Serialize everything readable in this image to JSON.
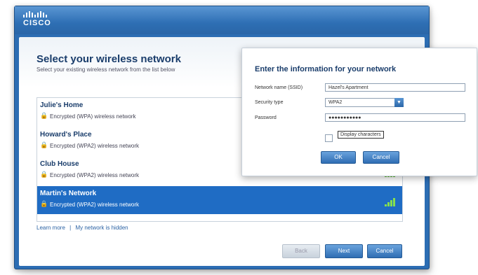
{
  "brand": {
    "logo_text": "CISCO"
  },
  "main": {
    "heading": "Select your wireless network",
    "subheading": "Select your existing wireless network from the list below",
    "networks": [
      {
        "name": "Julie's Home",
        "security": "Encrypted (WPA) wireless network",
        "speed": "",
        "selected": false
      },
      {
        "name": "Howard's Place",
        "security": "Encrypted (WPA2) wireless network",
        "speed": "",
        "selected": false
      },
      {
        "name": "Club House",
        "security": "Encrypted (WPA2) wireless network",
        "speed": "",
        "selected": false
      },
      {
        "name": "Martin's Network",
        "security": "Encrypted (WPA2) wireless network",
        "speed": "",
        "selected": true
      }
    ],
    "links": {
      "learn_more": "Learn more",
      "separator": "|",
      "not_listed": "My network is hidden"
    },
    "buttons": {
      "back": "Back",
      "next": "Next",
      "cancel": "Cancel"
    }
  },
  "dialog": {
    "title": "Enter the information for your network",
    "ssid_label": "Network name (SSID)",
    "ssid_value": "Hazel's Apartment",
    "security_label": "Security type",
    "security_value": "WPA2",
    "password_label": "Password",
    "password_value": "●●●●●●●●●●●",
    "display_characters_label": "Display characters",
    "buttons": {
      "ok": "OK",
      "cancel": "Cancel"
    }
  },
  "colors": {
    "accent": "#2c6db3",
    "selected_row": "#1f6cc4",
    "signal": "#5fb830"
  }
}
